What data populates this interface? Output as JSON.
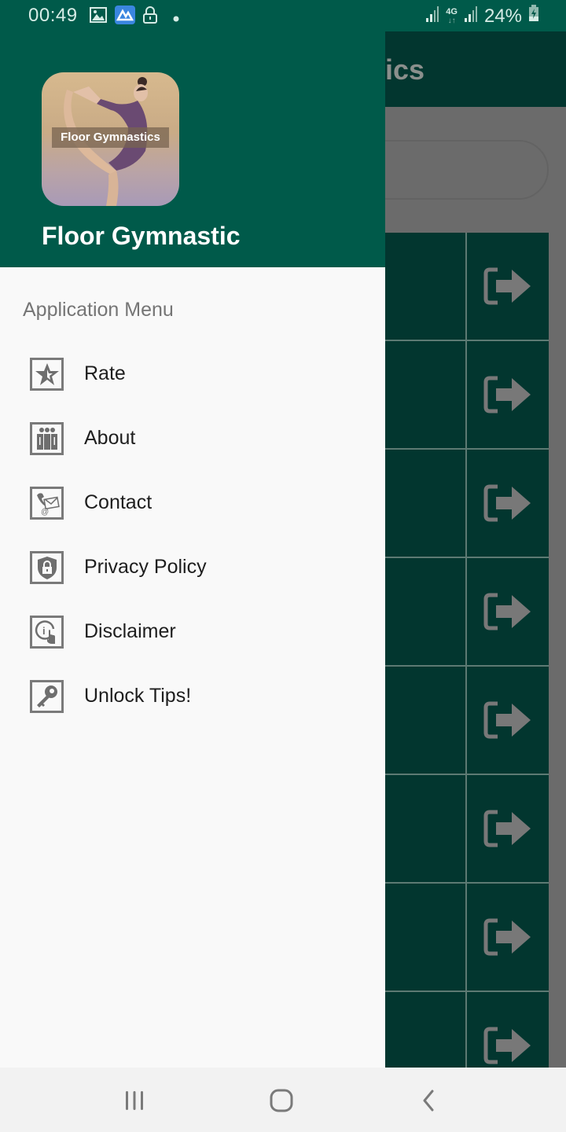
{
  "status_bar": {
    "time": "00:49",
    "left_icons": [
      "gallery-icon",
      "app-notification-icon",
      "lock-icon",
      "dot-icon"
    ],
    "network_label": "4G",
    "battery_percent": "24%",
    "battery_charging": true
  },
  "background_app": {
    "title_fragment": "ics",
    "row_count": 8,
    "row_action_icon": "exit-arrow-icon"
  },
  "drawer": {
    "logo_text": "Floor Gymnastics",
    "app_name": "Floor Gymnastic",
    "section_label": "Application Menu",
    "items": [
      {
        "label": "Rate",
        "icon": "star-icon"
      },
      {
        "label": "About",
        "icon": "people-icon"
      },
      {
        "label": "Contact",
        "icon": "phone-mail-icon"
      },
      {
        "label": "Privacy Policy",
        "icon": "shield-lock-icon"
      },
      {
        "label": "Disclaimer",
        "icon": "info-touch-icon"
      },
      {
        "label": "Unlock Tips!",
        "icon": "key-icon"
      }
    ]
  },
  "nav_bar": {
    "buttons": [
      "recent-apps",
      "home",
      "back"
    ]
  },
  "colors": {
    "primary": "#005a4a",
    "primary_dark_dimmed": "#02362f",
    "drawer_bg": "#f9f9f9",
    "icon_gray": "#7a7a7a",
    "scrim": "#6b6b6b"
  }
}
